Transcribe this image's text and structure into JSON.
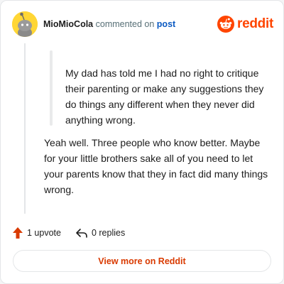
{
  "header": {
    "author": "MioMioCola",
    "action_text": "commented on",
    "post_link": "post",
    "brand": "reddit"
  },
  "comment": {
    "quote": "My dad has told me I had no right to critique their parenting or make any suggestions they do things any different when they never did anything wrong.",
    "body": "Yeah well. Three people who know better. Maybe for your little brothers sake all of you need to let your parents know that they in fact did many things wrong."
  },
  "actions": {
    "upvote_label": "1 upvote",
    "replies_label": "0 replies"
  },
  "footer": {
    "view_button": "View more on Reddit"
  },
  "colors": {
    "brand": "#ff4500",
    "link": "#0b5ac2",
    "button_text": "#d93a00",
    "avatar_bg": "#ffd635"
  },
  "icons": {
    "avatar": "snoo-avatar-icon",
    "brand": "reddit-logo-icon",
    "upvote": "upvote-arrow-icon",
    "reply": "reply-arrow-icon"
  }
}
